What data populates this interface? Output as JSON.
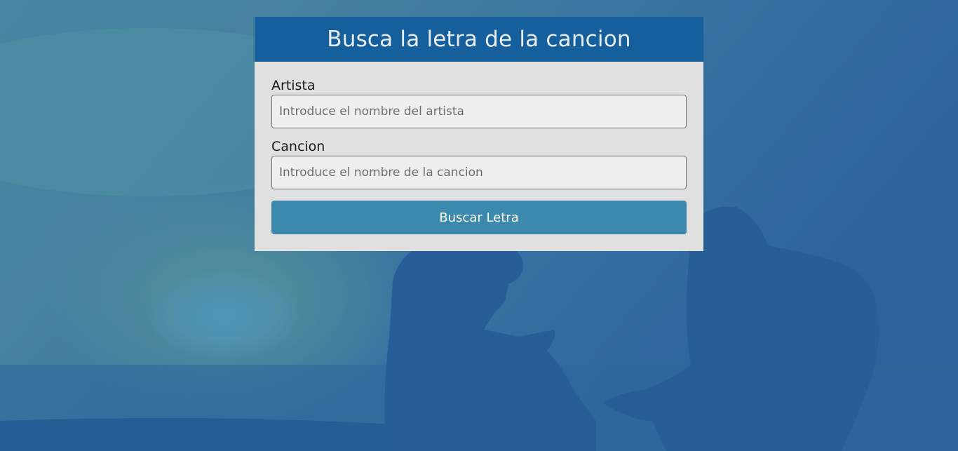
{
  "form": {
    "title": "Busca la letra de la cancion",
    "artist_label": "Artista",
    "artist_placeholder": "Introduce el nombre del artista",
    "artist_value": "",
    "song_label": "Cancion",
    "song_placeholder": "Introduce el nombre de la cancion",
    "song_value": "",
    "submit_label": "Buscar Letra"
  },
  "colors": {
    "header_bg": "#145f9c",
    "card_bg": "#e0e0e0",
    "button_bg": "#3c89ae",
    "overlay": "#1f5f96"
  }
}
